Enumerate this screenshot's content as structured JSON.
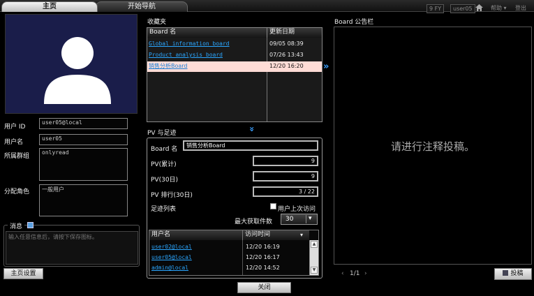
{
  "tabs": {
    "home": "主页",
    "nav": "开始导航"
  },
  "top_right": {
    "status": "9 FY",
    "user": "user05",
    "help": "帮助 ▾",
    "logout": "登出"
  },
  "profile": {
    "user_id_label": "用户 ID",
    "user_id": "user05@local",
    "user_name_label": "用户名",
    "user_name": "user05",
    "group_label": "所属群组",
    "group": "onlyread",
    "role_label": "分配角色",
    "role": "一般用户"
  },
  "message": {
    "title": "消息",
    "placeholder": "输入任意信息后，请按下保存图标。"
  },
  "home_settings_button": "主页设置",
  "favorites": {
    "title": "收藏夹",
    "headers": [
      "Board 名",
      "更新日期"
    ],
    "rows": [
      {
        "name": "Global information board",
        "date": "09/05 08:39"
      },
      {
        "name": "Product analysis board",
        "date": "07/26 13:43"
      },
      {
        "name": "销售分析Board",
        "date": "12/20 16:20"
      }
    ]
  },
  "pv": {
    "title": "PV 与足迹",
    "board_label": "Board 名",
    "board_value": "销售分析Board",
    "total_label": "PV(累计)",
    "total_value": "9",
    "days30_label": "PV(30日)",
    "days30_value": "9",
    "rank_label": "PV 排行(30日)",
    "rank_value": "3 / 22",
    "footprint_label": "足迹列表",
    "last_visit_label": "用户上次访问",
    "max_label": "最大获取件数",
    "max_value": "30",
    "visit_headers": [
      "用户名",
      "访问时间"
    ],
    "visits": [
      {
        "user": "user02@local",
        "time": "12/20 16:19"
      },
      {
        "user": "user05@local",
        "time": "12/20 16:17"
      },
      {
        "user": "admin@local",
        "time": "12/20 14:52"
      }
    ]
  },
  "close_button": "关闭",
  "board": {
    "title": "Board 公告栏",
    "empty_message": "请进行注释投稿。",
    "pager": "1/1",
    "post_button": "投稿"
  },
  "colors": {
    "link": "#2aa6ff",
    "selected_row": "#ffdcd6",
    "avatar_bg": "#1a1d4a"
  }
}
